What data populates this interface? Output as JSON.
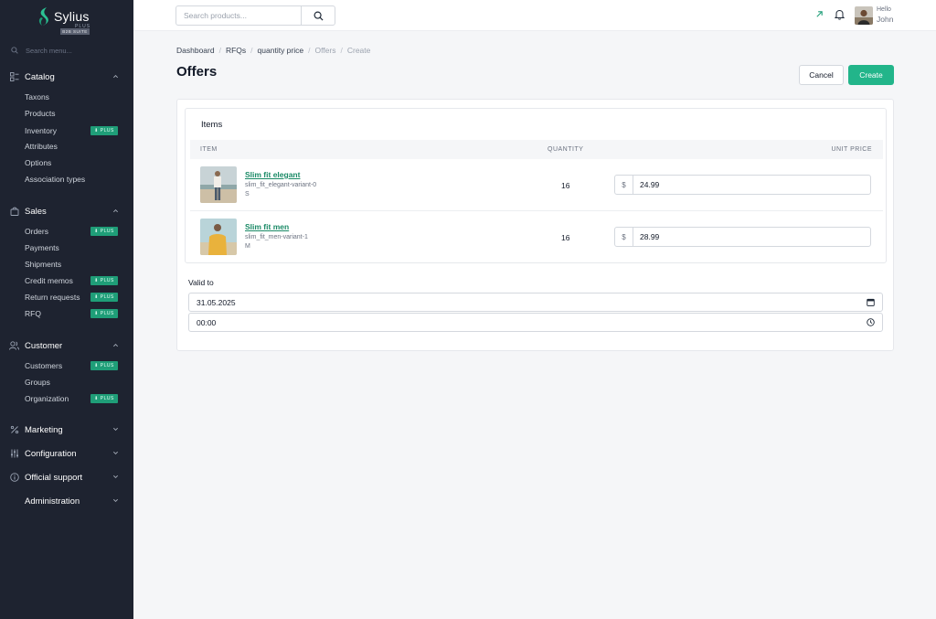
{
  "brand": {
    "name": "Sylius",
    "tier": "PLUS",
    "suite": "B2B SUITE"
  },
  "sidebar": {
    "search_placeholder": "Search menu...",
    "plus_badge": "⬇ PLUS",
    "sections": {
      "catalog": {
        "label": "Catalog",
        "items": [
          "Taxons",
          "Products",
          "Inventory",
          "Attributes",
          "Options",
          "Association types"
        ]
      },
      "sales": {
        "label": "Sales",
        "items": [
          "Orders",
          "Payments",
          "Shipments",
          "Credit memos",
          "Return requests",
          "RFQ"
        ]
      },
      "customer": {
        "label": "Customer",
        "items": [
          "Customers",
          "Groups",
          "Organization"
        ]
      },
      "marketing": {
        "label": "Marketing"
      },
      "configuration": {
        "label": "Configuration"
      },
      "support": {
        "label": "Official support"
      },
      "administration": {
        "label": "Administration"
      }
    }
  },
  "topbar": {
    "search_placeholder": "Search products...",
    "greeting": "Hello",
    "user_name": "John"
  },
  "breadcrumb": [
    "Dashboard",
    "RFQs",
    "quantity price",
    "Offers",
    "Create"
  ],
  "page": {
    "title": "Offers",
    "cancel_label": "Cancel",
    "create_label": "Create"
  },
  "items": {
    "title": "Items",
    "headers": {
      "item": "ITEM",
      "quantity": "QUANTITY",
      "unit_price": "UNIT PRICE"
    },
    "currency": "$",
    "rows": [
      {
        "name": "Slim fit elegant",
        "code": "slim_fit_elegant-variant-0",
        "size": "S",
        "quantity": "16",
        "price": "24.99"
      },
      {
        "name": "Slim fit men",
        "code": "slim_fit_men-variant-1",
        "size": "M",
        "quantity": "16",
        "price": "28.99"
      }
    ]
  },
  "valid_to": {
    "label": "Valid to",
    "date": "31.05.2025",
    "time": "00:00"
  }
}
